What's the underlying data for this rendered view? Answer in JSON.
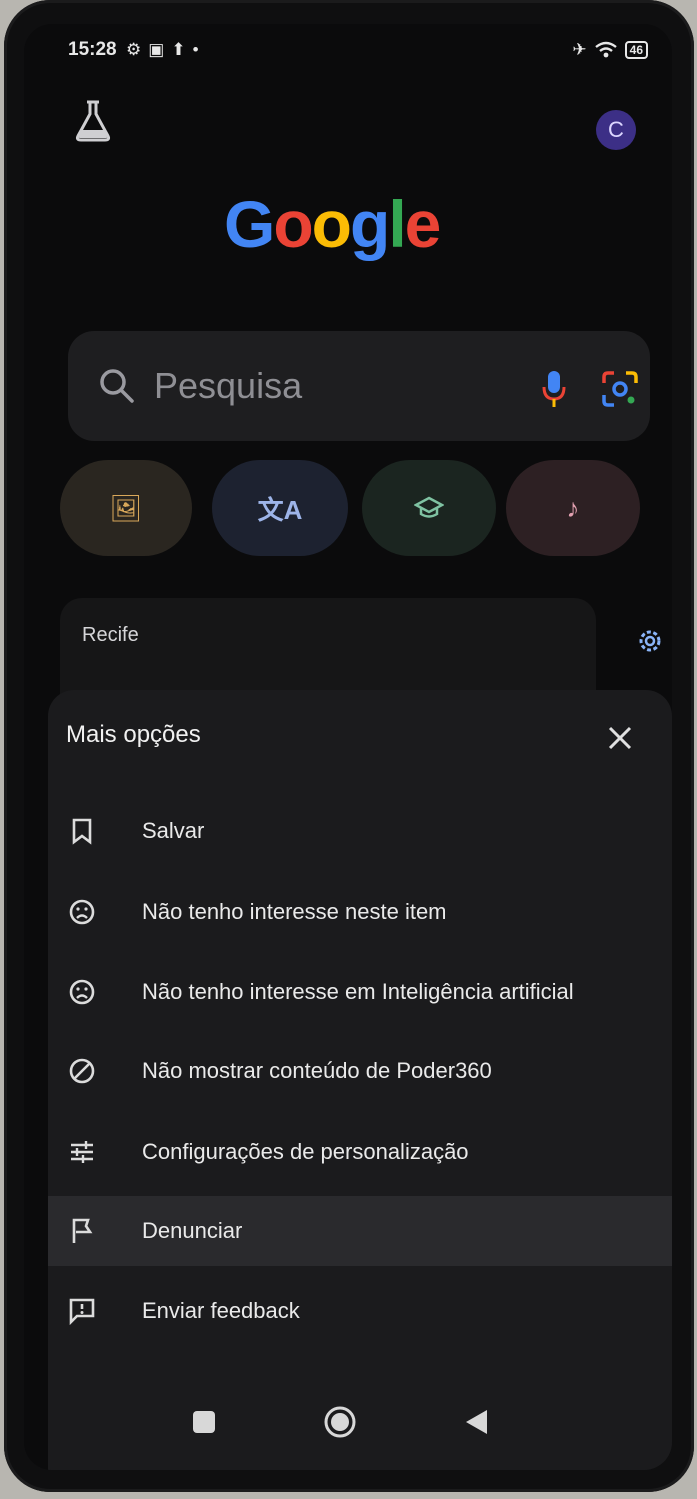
{
  "status_bar": {
    "time": "15:28",
    "battery": "46"
  },
  "header": {
    "avatar_letter": "C"
  },
  "logo": {
    "letters": [
      "G",
      "o",
      "o",
      "g",
      "l",
      "e"
    ]
  },
  "search": {
    "placeholder": "Pesquisa"
  },
  "weather": {
    "city": "Recife"
  },
  "sheet": {
    "title": "Mais opções",
    "items": [
      {
        "label": "Salvar",
        "icon": "bookmark-icon"
      },
      {
        "label": "Não tenho interesse neste item",
        "icon": "sad-face-icon"
      },
      {
        "label": "Não tenho interesse em Inteligência artificial",
        "icon": "sad-face-icon"
      },
      {
        "label": "Não mostrar conteúdo de Poder360",
        "icon": "block-icon"
      },
      {
        "label": "Configurações de personalização",
        "icon": "tune-icon"
      },
      {
        "label": "Denunciar",
        "icon": "flag-icon"
      },
      {
        "label": "Enviar feedback",
        "icon": "feedback-icon"
      }
    ]
  },
  "colors": {
    "background": "#0b0b0c",
    "sheet": "#1b1b1d",
    "avatar": "#3c2f86",
    "google_blue": "#4285f4",
    "google_red": "#ea4335",
    "google_yellow": "#fbbc05",
    "google_green": "#34a853"
  }
}
